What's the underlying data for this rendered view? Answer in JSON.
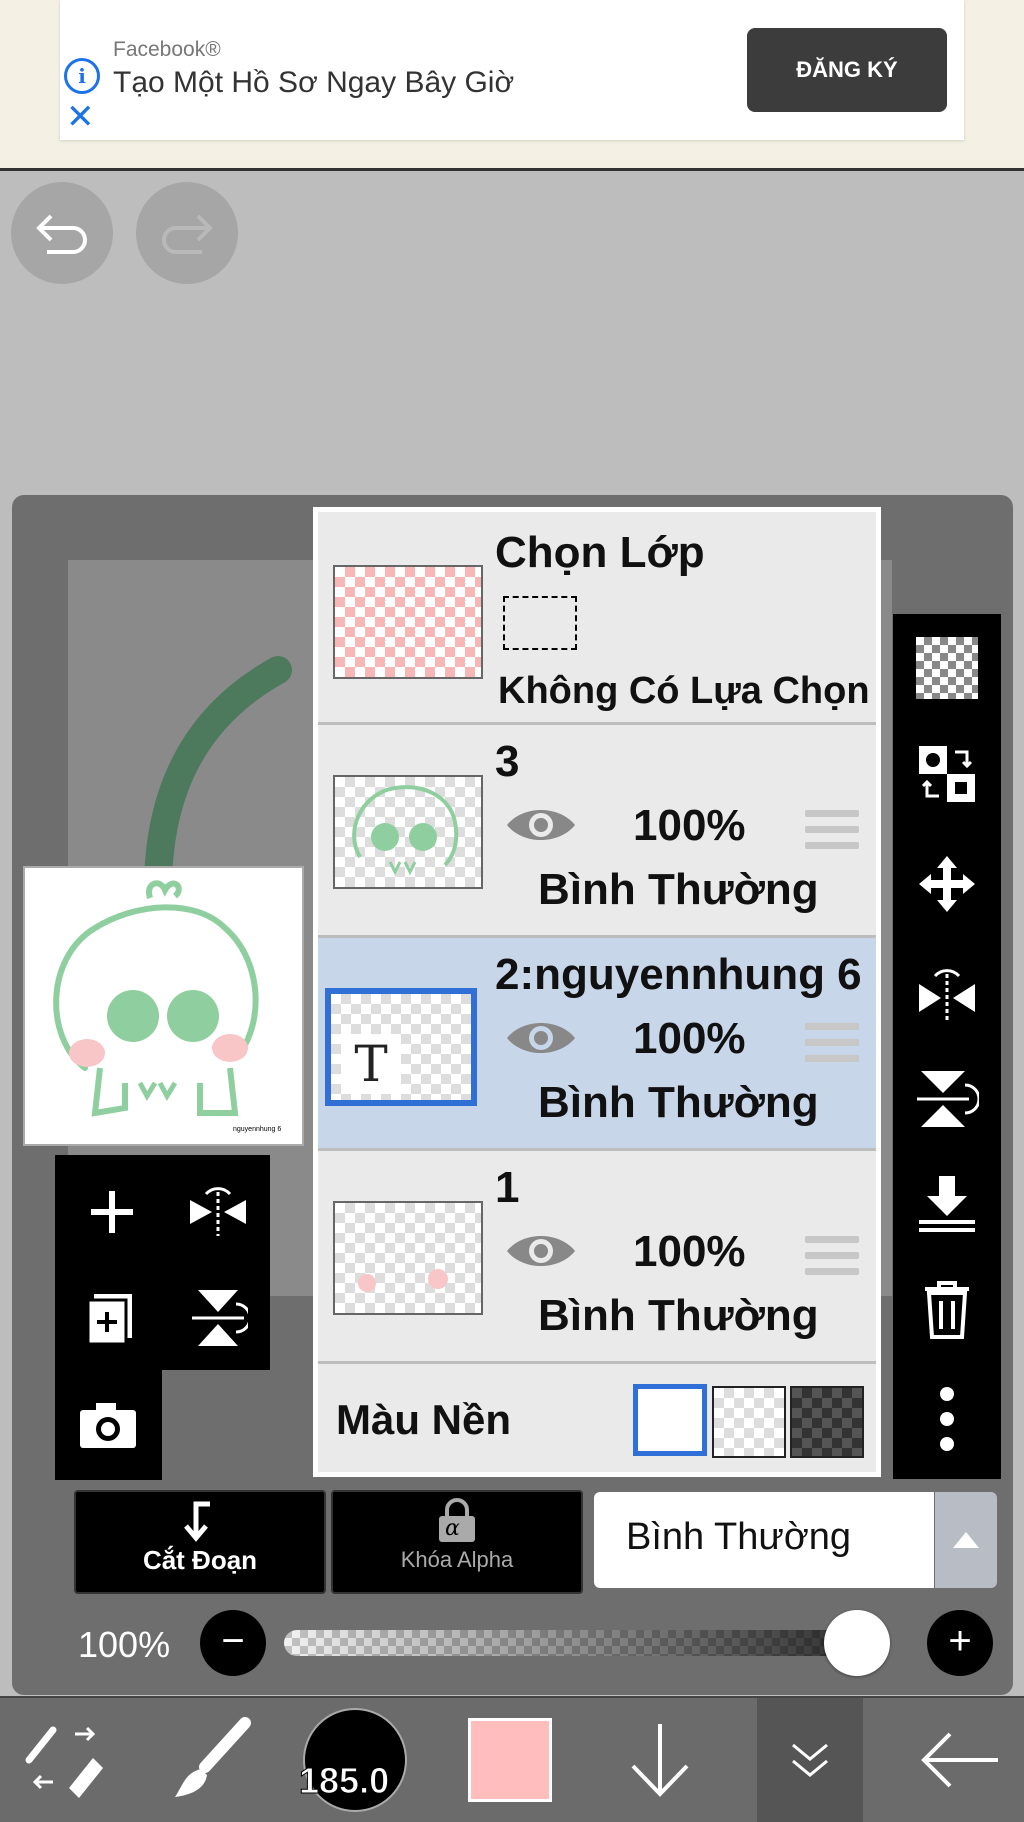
{
  "ad": {
    "brand": "Facebook®",
    "title": "Tạo Một Hồ Sơ Ngay Bây Giờ",
    "cta": "ĐĂNG KÝ"
  },
  "preview": {
    "watermark": "nguyennhung 6"
  },
  "layers": {
    "selection": {
      "title": "Chọn Lớp",
      "subtitle": "Không Có Lựa Chọn"
    },
    "items": [
      {
        "name": "3",
        "opacity": "100%",
        "blend": "Bình Thường",
        "selected": false
      },
      {
        "name": "2:nguyennhung 6",
        "opacity": "100%",
        "blend": "Bình Thường",
        "selected": true
      },
      {
        "name": "1",
        "opacity": "100%",
        "blend": "Bình Thường",
        "selected": false
      }
    ],
    "background": {
      "label": "Màu Nền",
      "options": [
        "white",
        "transparent",
        "dark"
      ],
      "selected": "white"
    }
  },
  "controls": {
    "clip_label": "Cắt Đoạn",
    "alpha_label": "Khóa Alpha",
    "alpha_icon": "α",
    "blend_mode": "Bình Thường",
    "opacity_label": "100%",
    "opacity_value": 1.0
  },
  "bottom_bar": {
    "brush_size": "185.0",
    "color": "#ffbdbd"
  },
  "colors": {
    "accent_blue": "#2f6fd6",
    "selected_row": "#c8d6ea",
    "toolbar_black": "#000000"
  }
}
